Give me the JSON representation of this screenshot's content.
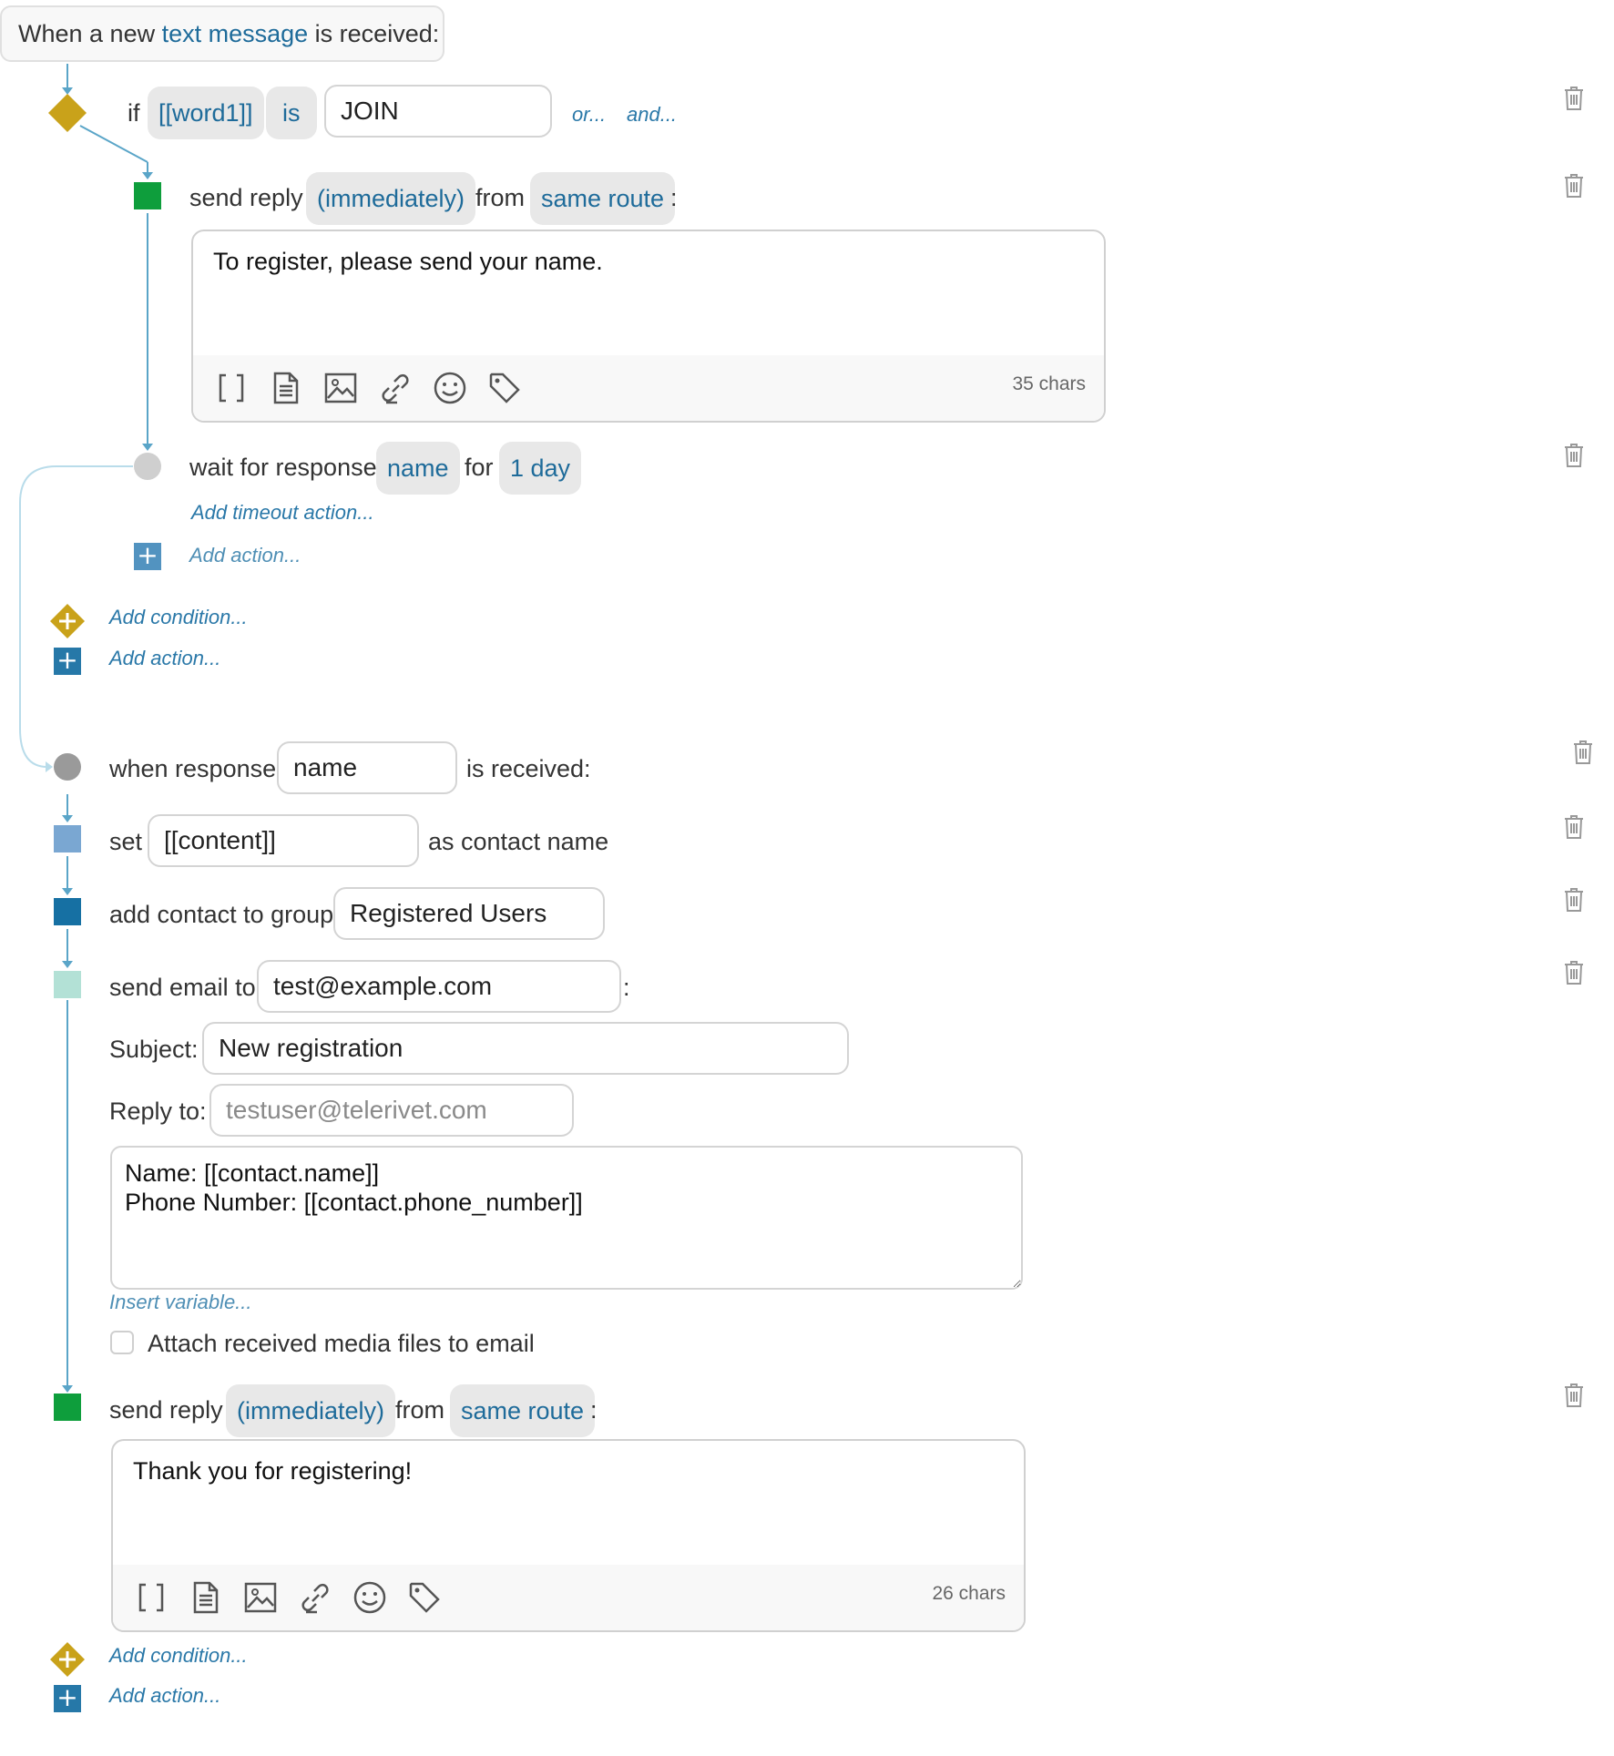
{
  "trigger": {
    "prefix": "When a new ",
    "link": "text message",
    "suffix": " is received:"
  },
  "condition": {
    "if_label": "if",
    "variable": "[[word1]]",
    "operator": "is",
    "value": "JOIN",
    "or_link": "or...",
    "and_link": "and..."
  },
  "reply1": {
    "label": "send reply",
    "timing": "(immediately)",
    "from_label": "from",
    "route": "same route",
    "colon": ":",
    "message": "To register, please send your name.",
    "char_count": "35 chars"
  },
  "wait": {
    "label": "wait for response",
    "var": "name",
    "for_label": "for",
    "duration": "1 day",
    "timeout_link": "Add timeout action...",
    "add_action": "Add action..."
  },
  "outer_links": {
    "add_condition": "Add condition...",
    "add_action": "Add action..."
  },
  "response": {
    "label": "when response",
    "var": "name",
    "suffix": "is received:"
  },
  "set_action": {
    "label": "set",
    "value": "[[content]]",
    "suffix": "as contact name"
  },
  "group_action": {
    "label": "add contact to group",
    "value": "Registered Users"
  },
  "email": {
    "label": "send email to",
    "to": "test@example.com",
    "colon": ":",
    "subject_label": "Subject:",
    "subject": "New registration",
    "reply_to_label": "Reply to:",
    "reply_to_placeholder": "testuser@telerivet.com",
    "body": "Name: [[contact.name]]\nPhone Number: [[contact.phone_number]]",
    "insert_variable": "Insert variable...",
    "attach_label": "Attach received media files to email"
  },
  "reply2": {
    "label": "send reply",
    "timing": "(immediately)",
    "from_label": "from",
    "route": "same route",
    "colon": ":",
    "message": "Thank you for registering!",
    "char_count": "26 chars"
  },
  "bottom_links": {
    "add_condition": "Add condition...",
    "add_action": "Add action..."
  },
  "colors": {
    "link": "#1e6b9a",
    "condition_diamond": "#c9a21a",
    "reply_square": "#0e9e3c",
    "set_square": "#7aa7d2",
    "group_square": "#1670a3",
    "email_square": "#b3e1d6",
    "connector": "#5aa5c8"
  }
}
